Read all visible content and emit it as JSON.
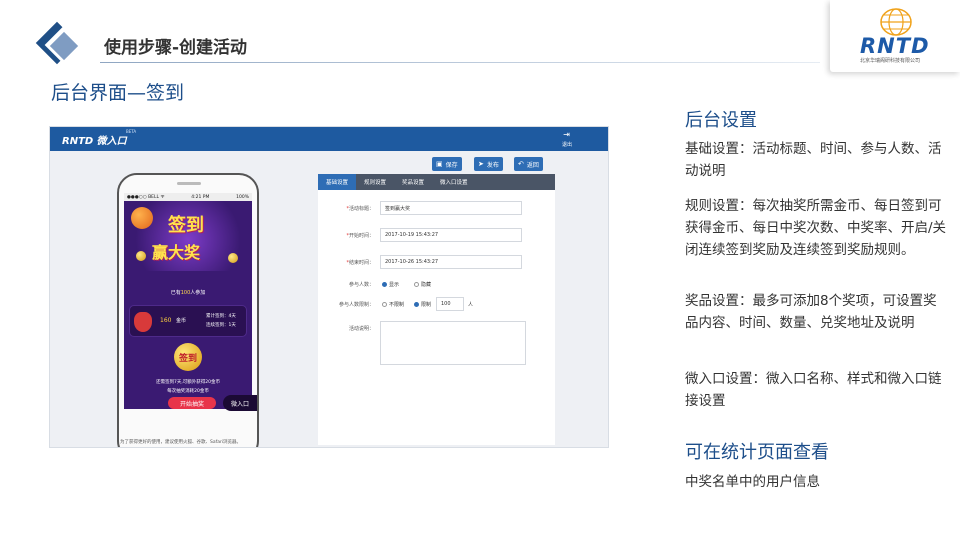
{
  "slide": {
    "title": "使用步骤-创建活动",
    "subtitle": "后台界面—签到",
    "logo_text": "RNTD",
    "logo_sub": "北京华瑞阁研科技有限公司"
  },
  "admin": {
    "brand": "RNTD 微入口",
    "brand_sup": "BETA",
    "exit_label": "退出",
    "buttons": {
      "save": "保存",
      "publish": "发布",
      "back": "返回"
    },
    "tabs": [
      {
        "label": "基础设置",
        "active": true
      },
      {
        "label": "规则设置",
        "active": false
      },
      {
        "label": "奖品设置",
        "active": false
      },
      {
        "label": "微入口设置",
        "active": false
      }
    ],
    "form": {
      "title_label": "活动标题：",
      "title_value": "签到赢大奖",
      "start_label": "开始时间：",
      "start_value": "2017-10-19 15:43:27",
      "end_label": "结束时间：",
      "end_value": "2017-10-26 15:43:27",
      "participants_label": "参与人数：",
      "participants_show": "显示",
      "participants_hide": "隐藏",
      "limit_label": "参与人数限制：",
      "limit_unlimited": "不限制",
      "limit_limited": "限制",
      "limit_value": "100",
      "limit_unit": "人",
      "desc_label": "活动说明："
    }
  },
  "phone": {
    "status_left": "●●●○○ BELL ᯤ",
    "status_time": "4:21 PM",
    "status_right": "100%",
    "banner_line1": "签到",
    "banner_line2": "赢大奖",
    "join_prefix": "已有",
    "join_count": "100",
    "join_suffix": "人参加",
    "coins": "160",
    "coins_unit": "金币",
    "cumulative": "累计签到：4天",
    "consecutive": "连续签到：1天",
    "sign_button": "签到",
    "info_line1": "还需签到7天,可额外获得20金币",
    "info_line2": "每次抽奖消耗20金币",
    "start_button": "开始抽奖",
    "entry_tag": "微入口",
    "note": "为了获得更好的使用，建议使用火狐、谷歌、Safari浏览器。"
  },
  "right": {
    "h1": "后台设置",
    "p1": "基础设置：活动标题、时间、参与人数、活动说明",
    "p2": "规则设置：每次抽奖所需金币、每日签到可获得金币、每日中奖次数、中奖率、开启/关闭连续签到奖励及连续签到奖励规则。",
    "p3": "奖品设置：最多可添加8个奖项，可设置奖品内容、时间、数量、兑奖地址及说明",
    "p4": "微入口设置：微入口名称、样式和微入口链接设置",
    "h2": "可在统计页面查看",
    "p5": "中奖名单中的用户信息"
  },
  "colors": {
    "accent": "#2e6db5",
    "topbar": "#1e5aa0",
    "heading": "#1d4e8a"
  }
}
